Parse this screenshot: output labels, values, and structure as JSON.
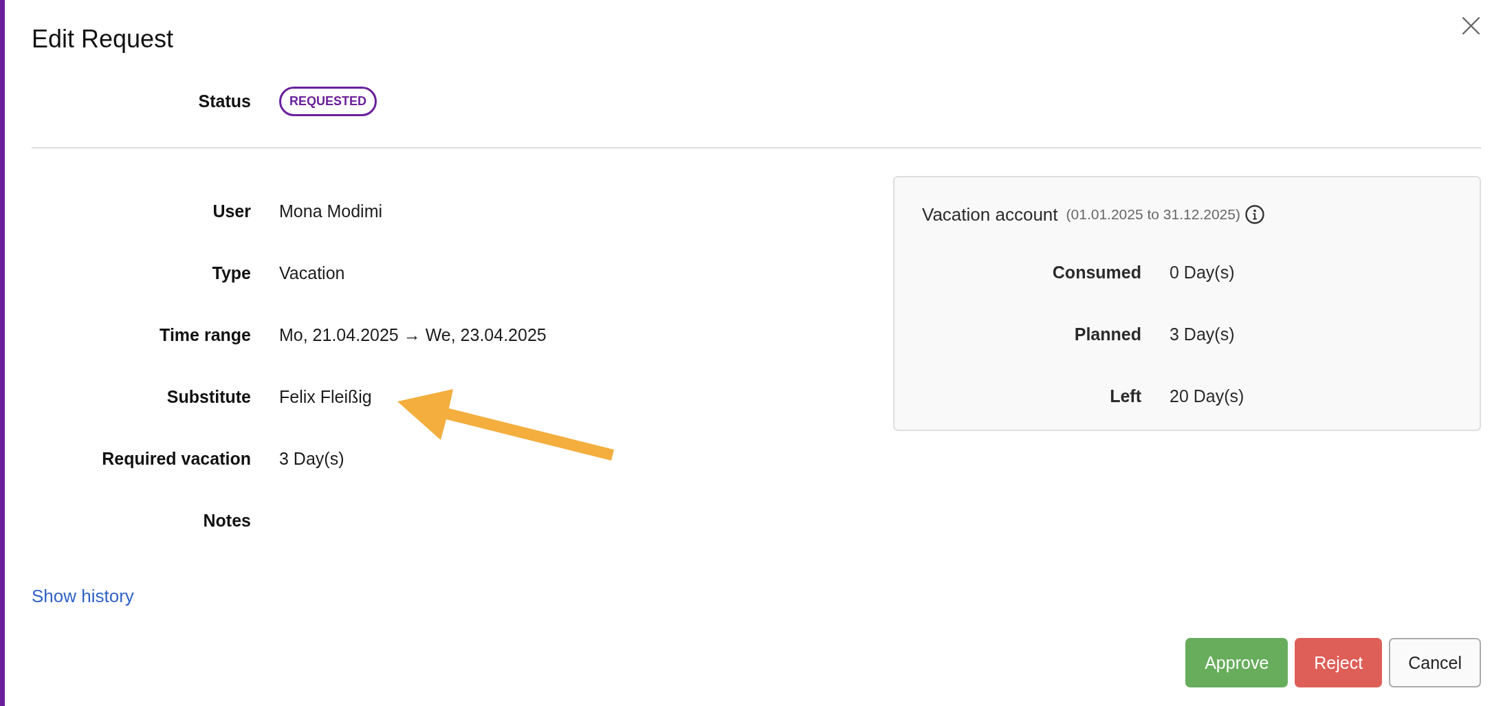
{
  "title": "Edit Request",
  "status": {
    "label": "Status",
    "value": "REQUESTED"
  },
  "fields": [
    {
      "label": "User",
      "value": "Mona Modimi"
    },
    {
      "label": "Type",
      "value": "Vacation"
    },
    {
      "label": "Time range",
      "value": "Mo, 21.04.2025 → We, 23.04.2025"
    },
    {
      "label": "Substitute",
      "value": "Felix Fleißig"
    },
    {
      "label": "Required vacation",
      "value": "3 Day(s)"
    },
    {
      "label": "Notes"
    }
  ],
  "vacation_account": {
    "title": "Vacation account",
    "period": "(01.01.2025 to 31.12.2025)",
    "rows": [
      {
        "label": "Consumed",
        "value": "0 Day(s)"
      },
      {
        "label": "Planned",
        "value": "3 Day(s)"
      },
      {
        "label": "Left",
        "value": "20 Day(s)"
      }
    ]
  },
  "history_link": "Show history",
  "buttons": [
    {
      "label": "Approve",
      "kind": "approve"
    },
    {
      "label": "Reject",
      "kind": "reject"
    },
    {
      "label": "Cancel",
      "kind": "cancel"
    }
  ]
}
